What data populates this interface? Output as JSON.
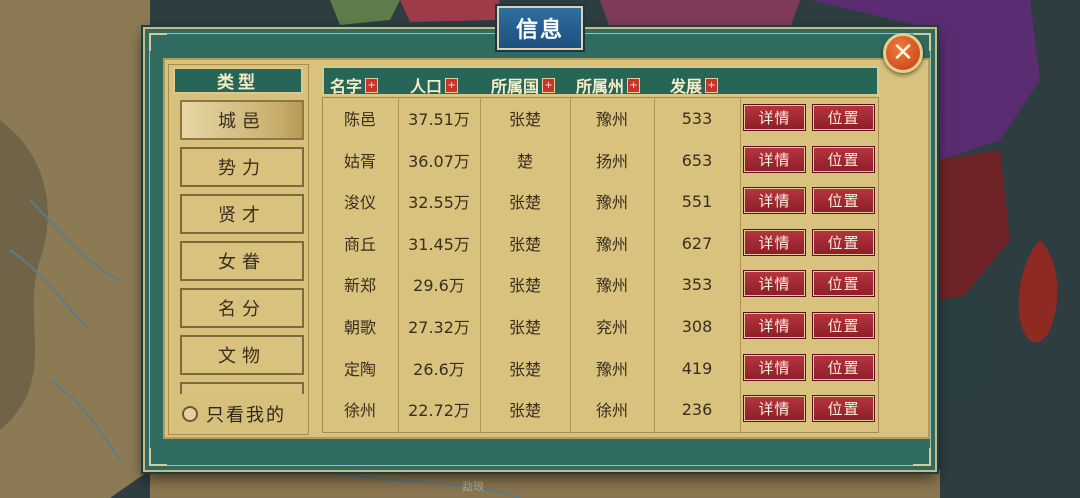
{
  "window": {
    "title": "信息",
    "close_glyph": "✕"
  },
  "map": {
    "bottom_label": "勐琅"
  },
  "sidebar": {
    "header": "类型",
    "items": [
      {
        "label": "城邑",
        "active": true
      },
      {
        "label": "势力",
        "active": false
      },
      {
        "label": "贤才",
        "active": false
      },
      {
        "label": "女眷",
        "active": false
      },
      {
        "label": "名分",
        "active": false
      },
      {
        "label": "文物",
        "active": false
      }
    ],
    "only_mine_label": "只看我的"
  },
  "table": {
    "sort_glyph": "+",
    "columns": [
      "名字",
      "人口",
      "所属国",
      "所属州",
      "发展"
    ],
    "rows": [
      {
        "name": "陈邑",
        "population": "37.51万",
        "country": "张楚",
        "province": "豫州",
        "development": "533"
      },
      {
        "name": "姑胥",
        "population": "36.07万",
        "country": "楚",
        "province": "扬州",
        "development": "653"
      },
      {
        "name": "浚仪",
        "population": "32.55万",
        "country": "张楚",
        "province": "豫州",
        "development": "551"
      },
      {
        "name": "商丘",
        "population": "31.45万",
        "country": "张楚",
        "province": "豫州",
        "development": "627"
      },
      {
        "name": "新郑",
        "population": "29.6万",
        "country": "张楚",
        "province": "豫州",
        "development": "353"
      },
      {
        "name": "朝歌",
        "population": "27.32万",
        "country": "张楚",
        "province": "兖州",
        "development": "308"
      },
      {
        "name": "定陶",
        "population": "26.6万",
        "country": "张楚",
        "province": "豫州",
        "development": "419"
      },
      {
        "name": "徐州",
        "population": "22.72万",
        "country": "张楚",
        "province": "徐州",
        "development": "236"
      }
    ],
    "detail_label": "详情",
    "location_label": "位置"
  },
  "colors": {
    "frame_green": "#2f6b60",
    "parchment": "#d8c27e",
    "header_green": "#276657",
    "button_red": "#a12a33",
    "title_blue": "#2f6fa1"
  }
}
